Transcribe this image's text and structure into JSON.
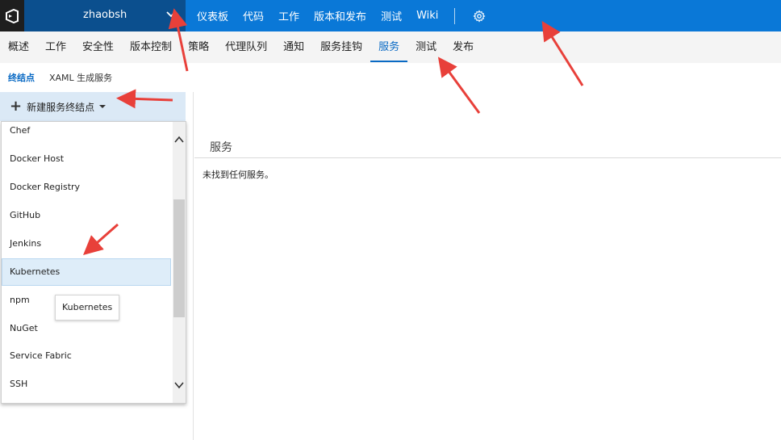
{
  "topbar": {
    "logo_icon": "visual-studio-logo-icon",
    "project_name": "zhaobsh",
    "project_chevron_icon": "chevron-down-icon",
    "nav_items": [
      "仪表板",
      "代码",
      "工作",
      "版本和发布",
      "测试",
      "Wiki"
    ],
    "settings_icon": "gear-icon"
  },
  "hubnav": {
    "tabs": [
      "概述",
      "工作",
      "安全性",
      "版本控制",
      "策略",
      "代理队列",
      "通知",
      "服务挂钩",
      "服务",
      "测试",
      "发布"
    ],
    "active": "服务"
  },
  "pivots": {
    "items": [
      "终结点",
      "XAML 生成服务"
    ],
    "active": "终结点"
  },
  "left": {
    "new_button_label": "新建服务终结点",
    "new_button_icon": "plus-icon",
    "caret_icon": "caret-down-icon"
  },
  "dropdown": {
    "items": [
      "Chef",
      "Docker Host",
      "Docker Registry",
      "GitHub",
      "Jenkins",
      "Kubernetes",
      "npm",
      "NuGet",
      "Service Fabric",
      "SSH"
    ],
    "hovered": "Kubernetes",
    "tooltip": "Kubernetes"
  },
  "content": {
    "section_title": "服务",
    "empty_message": "未找到任何服务。"
  },
  "colors": {
    "topbar": "#0a78d7",
    "project_bg": "#0b4f8e",
    "accent": "#0a6ac4",
    "annotation_arrow": "#e8403a"
  }
}
